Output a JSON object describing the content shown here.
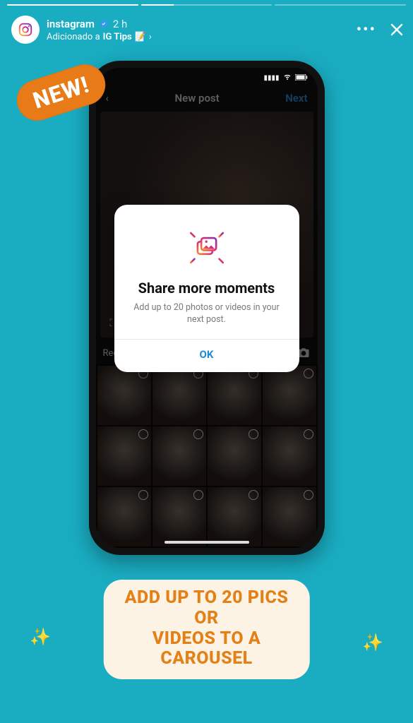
{
  "progress": {
    "segments": 3,
    "fill_percents": [
      100,
      25,
      0
    ]
  },
  "header": {
    "username": "instagram",
    "verified": true,
    "time": "2 h",
    "added_prefix": "Adicionado a",
    "highlight_name": "IG Tips",
    "highlight_emoji": "📝"
  },
  "badge": {
    "label": "NEW!"
  },
  "phone": {
    "topbar": {
      "back": "‹",
      "title": "New post",
      "next": "Next"
    },
    "recents_label": "Recents",
    "gallery_cells": 12
  },
  "modal": {
    "title": "Share more moments",
    "body": "Add up to 20 photos or videos in your next post.",
    "ok": "OK"
  },
  "caption": {
    "line1": "ADD UP TO 20 PICS OR",
    "line2": "VIDEOS TO A CAROUSEL"
  }
}
